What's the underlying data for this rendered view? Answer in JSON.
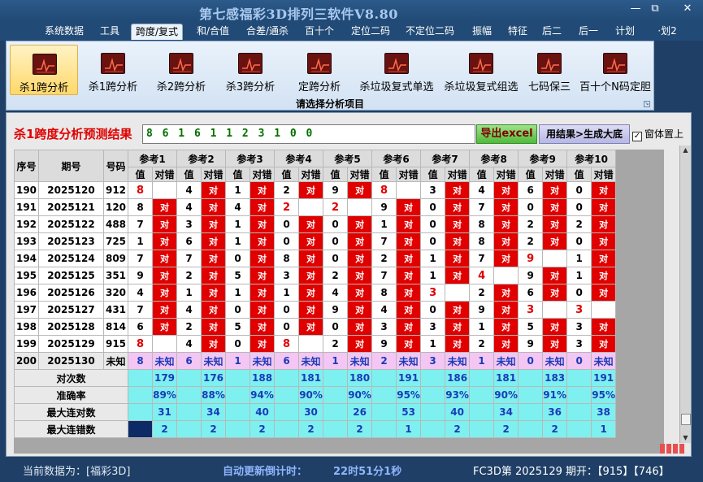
{
  "title": "第七感福彩3D排列三软件V8.80",
  "window_buttons": {
    "minimize": "—",
    "maximize": "⧉",
    "close": "✕"
  },
  "menu": [
    "系统数据",
    "工具",
    "跨度/复式",
    "和/合值",
    "合差/通杀",
    "百十个",
    "定位二码",
    "不定位二码",
    "振幅",
    "特征",
    "后二",
    "后一",
    "计划",
    "·划2"
  ],
  "menu_active_index": 2,
  "ribbon": {
    "buttons": [
      "杀1跨分析",
      "杀1跨分析",
      "杀2跨分析",
      "杀3跨分析",
      "定跨分析",
      "杀垃圾复式单选",
      "杀垃圾复式组选",
      "七码保三",
      "百十个N码定胆"
    ],
    "selected_index": 0,
    "group_label": "请选择分析项目"
  },
  "result": {
    "label": "杀1跨度分析预测结果",
    "digits": "8 6 1 6 1 1 2 3 1 0 0",
    "excel_button": "导出excel",
    "generate_button": "用结果>生成大底",
    "topmost_label": "窗体置上",
    "topmost_checked": true
  },
  "table": {
    "col_headers": [
      "序号",
      "期号",
      "号码"
    ],
    "ref_headers": [
      "参考1",
      "参考2",
      "参考3",
      "参考4",
      "参考5",
      "参考6",
      "参考7",
      "参考8",
      "参考9",
      "参考10"
    ],
    "sub_headers": [
      "值",
      "对错"
    ],
    "hit_text": "对",
    "rows": [
      {
        "seq": "190",
        "issue": "2025120",
        "num": "912",
        "vals": [
          "8",
          "4",
          "1",
          "2",
          "9",
          "8",
          "3",
          "4",
          "6",
          "0"
        ],
        "hits": [
          0,
          1,
          1,
          1,
          1,
          0,
          1,
          1,
          1,
          1
        ]
      },
      {
        "seq": "191",
        "issue": "2025121",
        "num": "120",
        "vals": [
          "8",
          "4",
          "4",
          "2",
          "2",
          "9",
          "0",
          "7",
          "0",
          "0"
        ],
        "hits": [
          1,
          1,
          1,
          0,
          0,
          1,
          1,
          1,
          1,
          1
        ]
      },
      {
        "seq": "192",
        "issue": "2025122",
        "num": "488",
        "vals": [
          "7",
          "3",
          "1",
          "0",
          "0",
          "1",
          "0",
          "8",
          "2",
          "2"
        ],
        "hits": [
          1,
          1,
          1,
          1,
          1,
          1,
          1,
          1,
          1,
          1
        ]
      },
      {
        "seq": "193",
        "issue": "2025123",
        "num": "725",
        "vals": [
          "1",
          "6",
          "1",
          "0",
          "0",
          "7",
          "0",
          "8",
          "2",
          "0"
        ],
        "hits": [
          1,
          1,
          1,
          1,
          1,
          1,
          1,
          1,
          1,
          1
        ]
      },
      {
        "seq": "194",
        "issue": "2025124",
        "num": "809",
        "vals": [
          "7",
          "7",
          "0",
          "8",
          "0",
          "2",
          "1",
          "7",
          "9",
          "1"
        ],
        "hits": [
          1,
          1,
          1,
          1,
          1,
          1,
          1,
          1,
          0,
          1
        ]
      },
      {
        "seq": "195",
        "issue": "2025125",
        "num": "351",
        "vals": [
          "9",
          "2",
          "5",
          "3",
          "2",
          "7",
          "1",
          "4",
          "9",
          "1"
        ],
        "hits": [
          1,
          1,
          1,
          1,
          1,
          1,
          1,
          0,
          1,
          1
        ]
      },
      {
        "seq": "196",
        "issue": "2025126",
        "num": "320",
        "vals": [
          "4",
          "1",
          "1",
          "1",
          "4",
          "8",
          "3",
          "2",
          "6",
          "0"
        ],
        "hits": [
          1,
          1,
          1,
          1,
          1,
          1,
          0,
          1,
          1,
          1
        ]
      },
      {
        "seq": "197",
        "issue": "2025127",
        "num": "431",
        "vals": [
          "7",
          "4",
          "0",
          "0",
          "9",
          "4",
          "0",
          "9",
          "3",
          "3"
        ],
        "hits": [
          1,
          1,
          1,
          1,
          1,
          1,
          1,
          1,
          0,
          0
        ]
      },
      {
        "seq": "198",
        "issue": "2025128",
        "num": "814",
        "vals": [
          "6",
          "2",
          "5",
          "0",
          "0",
          "3",
          "3",
          "1",
          "5",
          "3"
        ],
        "hits": [
          1,
          1,
          1,
          1,
          1,
          1,
          1,
          1,
          1,
          1
        ]
      },
      {
        "seq": "199",
        "issue": "2025129",
        "num": "915",
        "vals": [
          "8",
          "4",
          "0",
          "8",
          "2",
          "9",
          "1",
          "2",
          "9",
          "3"
        ],
        "hits": [
          0,
          1,
          1,
          0,
          1,
          1,
          1,
          1,
          1,
          1
        ]
      }
    ],
    "red_vals": [
      [
        1,
        0,
        0,
        0,
        0,
        1,
        0,
        0,
        0,
        0
      ],
      [
        0,
        0,
        0,
        1,
        1,
        0,
        0,
        0,
        0,
        0
      ],
      [
        0,
        0,
        0,
        0,
        0,
        0,
        0,
        0,
        0,
        0
      ],
      [
        0,
        0,
        0,
        0,
        0,
        0,
        0,
        0,
        0,
        0
      ],
      [
        0,
        0,
        0,
        0,
        0,
        0,
        0,
        0,
        1,
        0
      ],
      [
        0,
        0,
        0,
        0,
        0,
        0,
        0,
        1,
        0,
        0
      ],
      [
        0,
        0,
        0,
        0,
        0,
        0,
        1,
        0,
        0,
        0
      ],
      [
        0,
        0,
        0,
        0,
        0,
        0,
        0,
        0,
        1,
        1
      ],
      [
        0,
        0,
        0,
        0,
        0,
        0,
        0,
        0,
        0,
        0
      ],
      [
        1,
        0,
        0,
        1,
        0,
        0,
        0,
        0,
        0,
        0
      ]
    ],
    "unknown_row": {
      "seq": "200",
      "issue": "2025130",
      "num": "未知",
      "vals": [
        "8",
        "6",
        "1",
        "6",
        "1",
        "2",
        "3",
        "1",
        "0",
        "0"
      ],
      "text": "未知"
    },
    "stats": [
      {
        "label": "对次数",
        "values": [
          "179",
          "176",
          "188",
          "181",
          "180",
          "191",
          "186",
          "181",
          "183",
          "191"
        ]
      },
      {
        "label": "准确率",
        "values": [
          "89%",
          "88%",
          "94%",
          "90%",
          "90%",
          "95%",
          "93%",
          "90%",
          "91%",
          "95%"
        ]
      },
      {
        "label": "最大连对数",
        "values": [
          "31",
          "34",
          "40",
          "30",
          "26",
          "53",
          "40",
          "34",
          "36",
          "38"
        ]
      },
      {
        "label": "最大连错数",
        "values": [
          "2",
          "2",
          "2",
          "2",
          "2",
          "1",
          "2",
          "2",
          "2",
          "1"
        ]
      }
    ]
  },
  "status": {
    "current_data": "当前数据为：[福彩3D]",
    "countdown_label": "自动更新倒计时：",
    "countdown": "22时51分1秒",
    "draw_info": "FC3D第 2025129 期开：【915】【746】"
  },
  "colors": {
    "hit_red": "#e00000",
    "stat_cyan": "#7ff0f0",
    "unknown_pink": "#f4c6f4",
    "stat_text": "#1a3bb8"
  }
}
